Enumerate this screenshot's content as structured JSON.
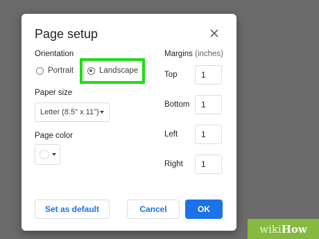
{
  "dialog": {
    "title": "Page setup",
    "close_icon": "close-icon"
  },
  "orientation": {
    "label": "Orientation",
    "options": [
      {
        "label": "Portrait",
        "selected": false
      },
      {
        "label": "Landscape",
        "selected": true
      }
    ],
    "highlight_color": "#1fdc14"
  },
  "paper_size": {
    "label": "Paper size",
    "value": "Letter (8.5\" x 11\")"
  },
  "page_color": {
    "label": "Page color",
    "value": "#ffffff"
  },
  "margins": {
    "label": "Margins",
    "unit": "(inches)",
    "fields": [
      {
        "label": "Top",
        "value": "1"
      },
      {
        "label": "Bottom",
        "value": "1"
      },
      {
        "label": "Left",
        "value": "1"
      },
      {
        "label": "Right",
        "value": "1"
      }
    ]
  },
  "buttons": {
    "set_default": "Set as default",
    "cancel": "Cancel",
    "ok": "OK"
  },
  "colors": {
    "accent": "#1a73e8",
    "overlay": "#6b6b6b"
  },
  "watermark": {
    "part1": "wiki",
    "part2": "How"
  }
}
